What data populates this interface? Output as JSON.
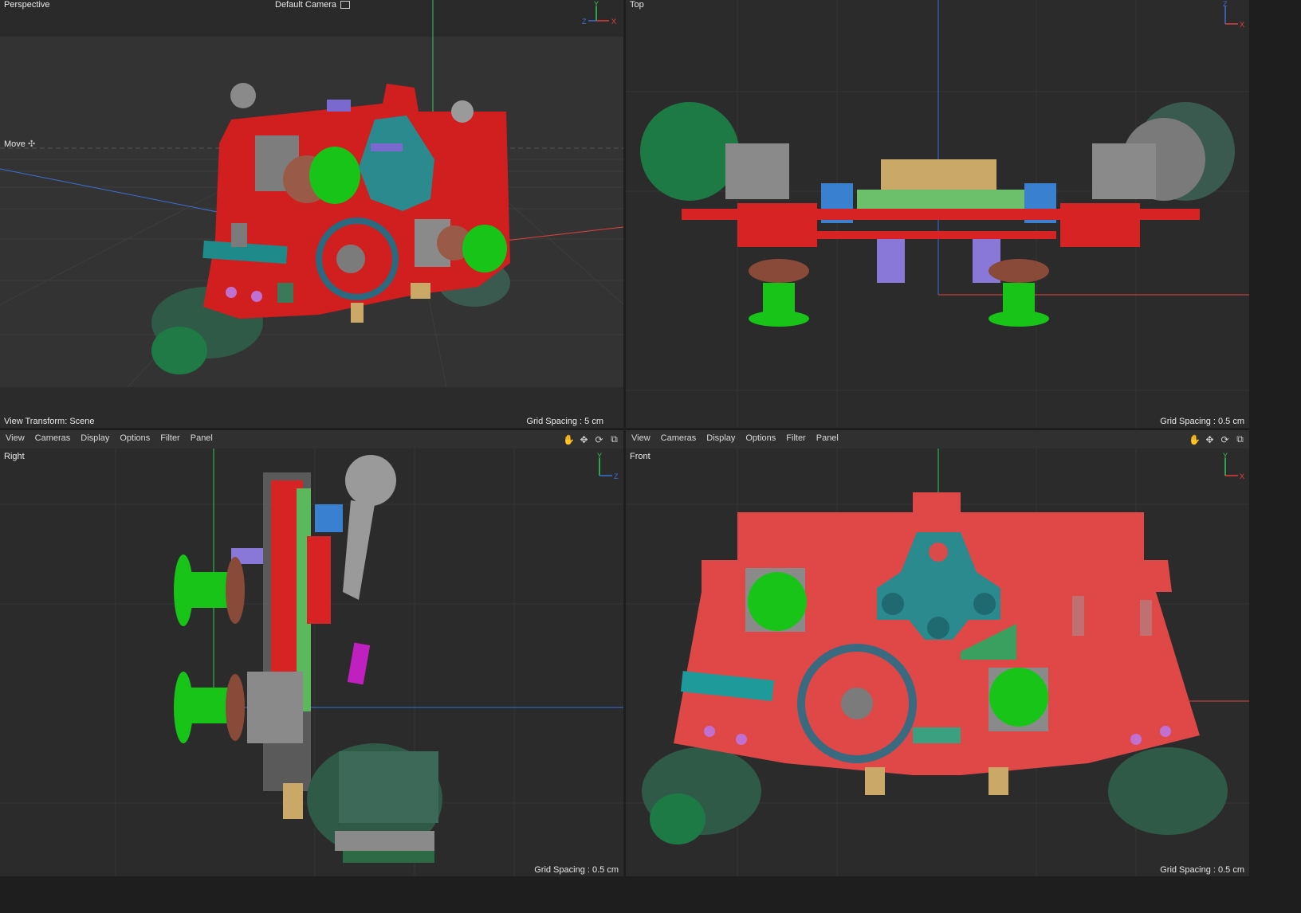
{
  "viewports": {
    "perspective": {
      "label": "Perspective",
      "camera": "Default Camera",
      "camera_icon": "camera-link-icon",
      "tool": "Move",
      "tool_icon": "move-icon",
      "view_transform": "View Transform: Scene",
      "grid_spacing": "Grid Spacing : 5 cm"
    },
    "top": {
      "label": "Top",
      "grid_spacing": "Grid Spacing : 0.5 cm"
    },
    "right": {
      "label": "Right",
      "grid_spacing": "Grid Spacing : 0.5 cm"
    },
    "front": {
      "label": "Front",
      "grid_spacing": "Grid Spacing : 0.5 cm"
    }
  },
  "menubar_left": {
    "items": [
      "View",
      "Cameras",
      "Display",
      "Options",
      "Filter",
      "Panel"
    ],
    "icons": [
      "hand-pan-icon",
      "move-arrows-icon",
      "rotate-icon",
      "maximize-icon"
    ]
  },
  "menubar_right": {
    "items": [
      "View",
      "Cameras",
      "Display",
      "Options",
      "Filter",
      "Panel"
    ],
    "icons": [
      "hand-pan-icon",
      "move-arrows-icon",
      "rotate-icon",
      "maximize-icon"
    ]
  },
  "axes": {
    "perspective": [
      "Y",
      "Z",
      "X"
    ],
    "top": [
      "Z",
      "X"
    ],
    "right": [
      "Y",
      "Z"
    ],
    "front": [
      "Y",
      "X"
    ]
  },
  "colors": {
    "background": "#2b2b2b",
    "board_red": "#d72323",
    "board_red_flat": "#e04848",
    "teal": "#2a8a8e",
    "green_stick": "#1fd41f",
    "dark_green": "#2e5a45",
    "brown": "#8a4a3a",
    "purple": "#8a78d8",
    "tan": "#c9a868",
    "gray": "#8a8a8a",
    "y_axis": "#34c759",
    "x_axis": "#e34040",
    "z_axis": "#3d6fd6"
  }
}
